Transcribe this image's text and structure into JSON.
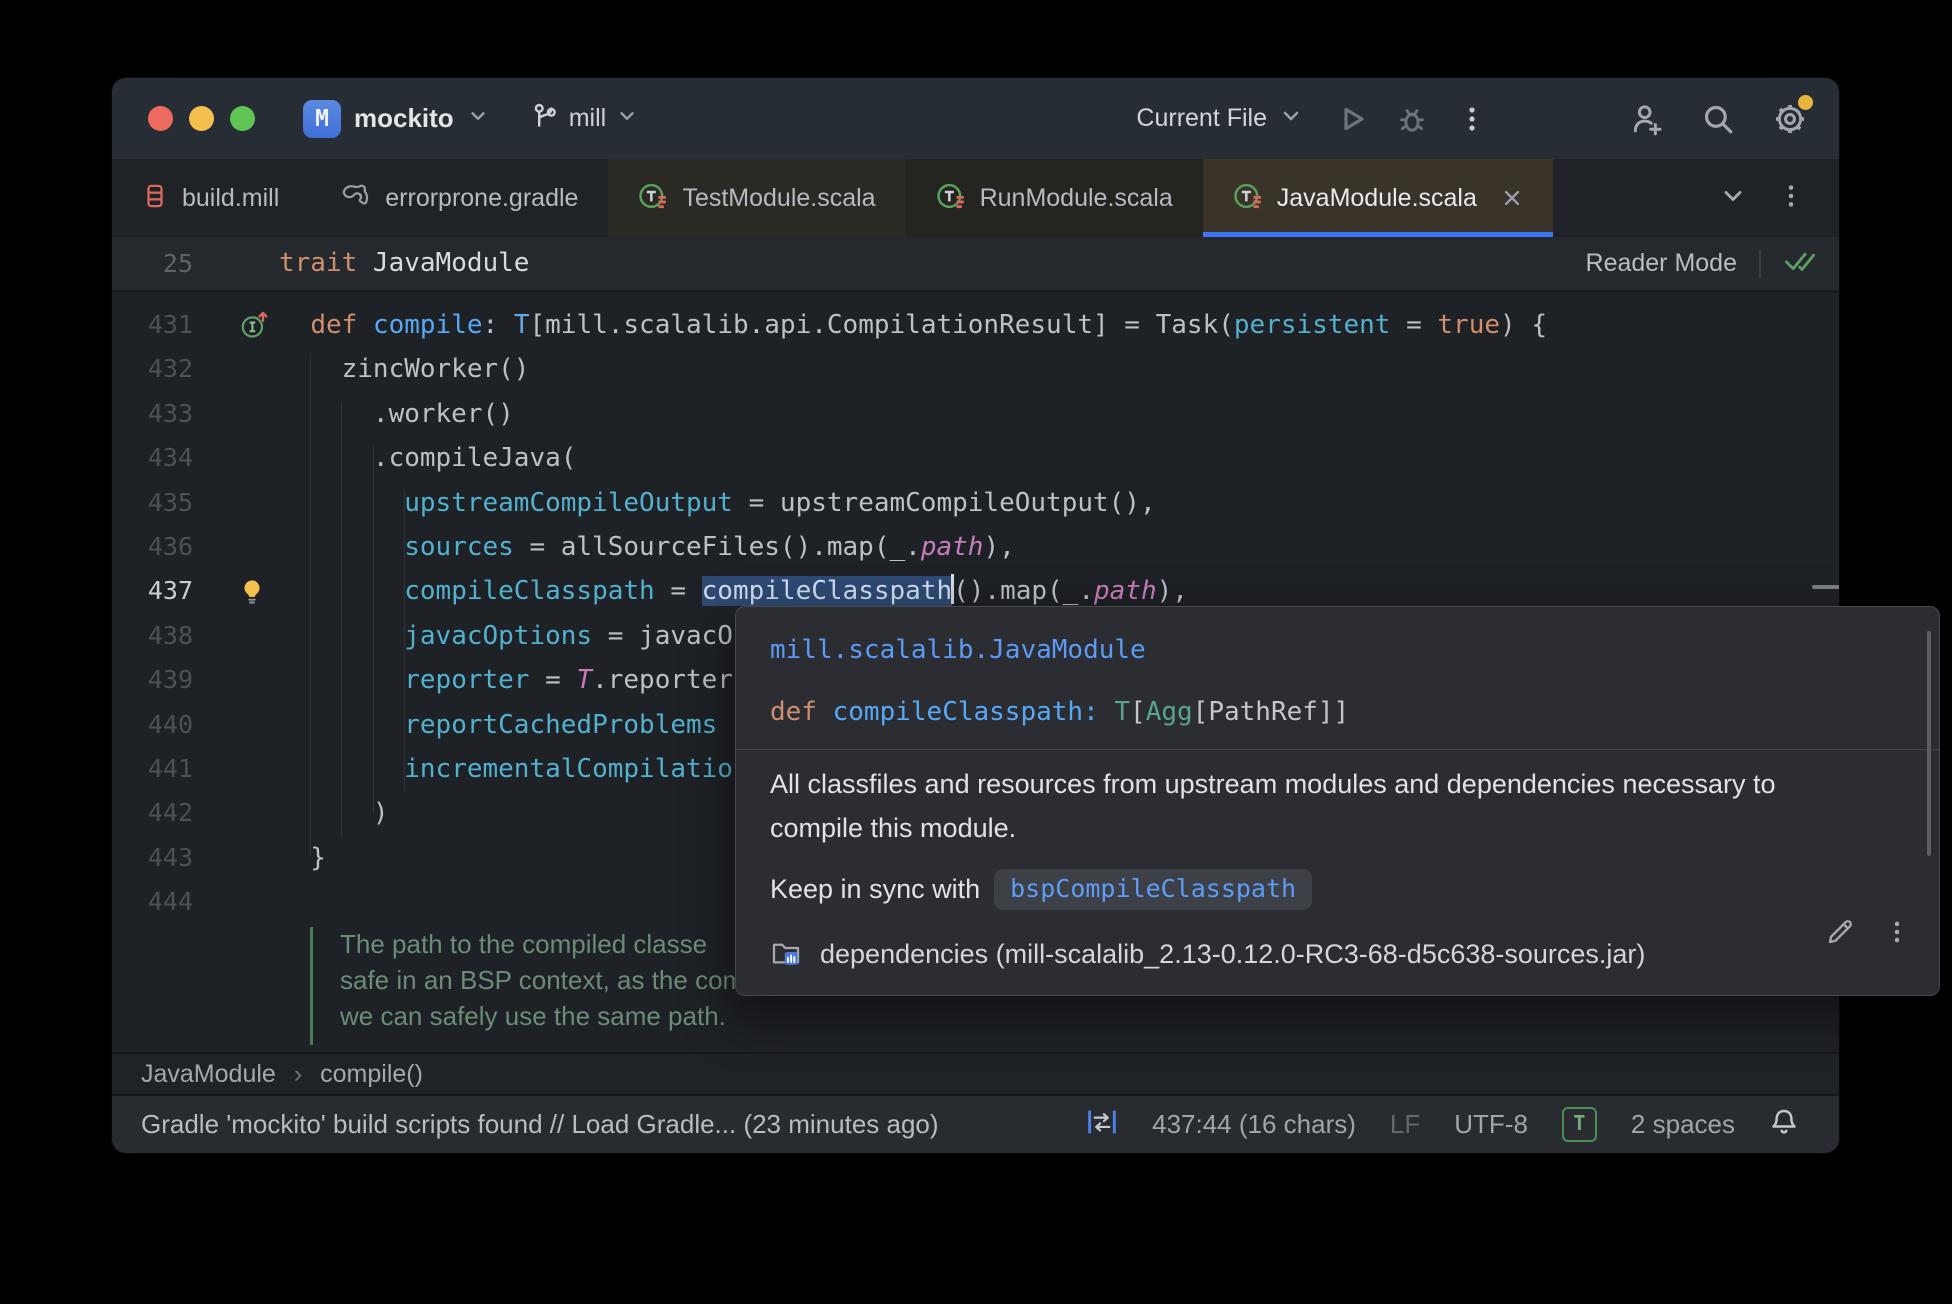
{
  "titlebar": {
    "project_badge": "M",
    "project_name": "mockito",
    "branch_name": "mill",
    "run_config": "Current File"
  },
  "tabs": [
    {
      "label": "build.mill"
    },
    {
      "label": "errorprone.gradle"
    },
    {
      "label": "TestModule.scala"
    },
    {
      "label": "RunModule.scala"
    },
    {
      "label": "JavaModule.scala",
      "active": true
    }
  ],
  "sticky_header": {
    "line_number": "25",
    "code": [
      {
        "t": "trait ",
        "c": "kw"
      },
      {
        "t": "JavaModule",
        "c": "plain2"
      }
    ],
    "reader_mode_label": "Reader Mode"
  },
  "editor": {
    "lines": [
      {
        "num": "431",
        "segments": [
          {
            "t": "  ",
            "c": "plain"
          },
          {
            "t": "def ",
            "c": "kw"
          },
          {
            "t": "compile",
            "c": "fn"
          },
          {
            "t": ": ",
            "c": "plain"
          },
          {
            "t": "T",
            "c": "type"
          },
          {
            "t": "[mill.scalalib.api.CompilationResult] = Task(",
            "c": "plain"
          },
          {
            "t": "persistent",
            "c": "param"
          },
          {
            "t": " = ",
            "c": "plain"
          },
          {
            "t": "true",
            "c": "kw"
          },
          {
            "t": ") {",
            "c": "plain"
          }
        ]
      },
      {
        "num": "432",
        "segments": [
          {
            "t": "    zincWorker()",
            "c": "plain"
          }
        ]
      },
      {
        "num": "433",
        "segments": [
          {
            "t": "      .worker()",
            "c": "plain"
          }
        ]
      },
      {
        "num": "434",
        "segments": [
          {
            "t": "      .compileJava(",
            "c": "plain"
          }
        ]
      },
      {
        "num": "435",
        "segments": [
          {
            "t": "        ",
            "c": "plain"
          },
          {
            "t": "upstreamCompileOutput",
            "c": "param"
          },
          {
            "t": " = upstreamCompileOutput(),",
            "c": "plain"
          }
        ]
      },
      {
        "num": "436",
        "segments": [
          {
            "t": "        ",
            "c": "plain"
          },
          {
            "t": "sources",
            "c": "param"
          },
          {
            "t": " = allSourceFiles().map(_.",
            "c": "plain"
          },
          {
            "t": "path",
            "c": "field"
          },
          {
            "t": "),",
            "c": "plain"
          }
        ]
      },
      {
        "num": "437",
        "segments": [
          {
            "t": "        ",
            "c": "plain"
          },
          {
            "t": "compileClasspath",
            "c": "param"
          },
          {
            "t": " = ",
            "c": "plain"
          },
          {
            "t": "compileClasspath",
            "c": "sel"
          },
          {
            "t": "",
            "c": "caret"
          },
          {
            "t": "().map(_.",
            "c": "plain"
          },
          {
            "t": "path",
            "c": "field"
          },
          {
            "t": "),",
            "c": "plain"
          }
        ]
      },
      {
        "num": "438",
        "segments": [
          {
            "t": "        ",
            "c": "plain"
          },
          {
            "t": "javacOptions",
            "c": "param"
          },
          {
            "t": " = javacO",
            "c": "plain"
          }
        ]
      },
      {
        "num": "439",
        "segments": [
          {
            "t": "        ",
            "c": "plain"
          },
          {
            "t": "reporter",
            "c": "param"
          },
          {
            "t": " = ",
            "c": "plain"
          },
          {
            "t": "T",
            "c": "field"
          },
          {
            "t": ".reporter",
            "c": "plain"
          }
        ]
      },
      {
        "num": "440",
        "segments": [
          {
            "t": "        ",
            "c": "plain"
          },
          {
            "t": "reportCachedProblems ",
            "c": "param"
          }
        ]
      },
      {
        "num": "441",
        "segments": [
          {
            "t": "        ",
            "c": "plain"
          },
          {
            "t": "incrementalCompilatio",
            "c": "param"
          }
        ]
      },
      {
        "num": "442",
        "segments": [
          {
            "t": "      )",
            "c": "plain"
          }
        ]
      },
      {
        "num": "443",
        "segments": [
          {
            "t": "  }",
            "c": "plain"
          }
        ]
      },
      {
        "num": "444",
        "segments": []
      }
    ]
  },
  "doc_comment": {
    "lines": [
      "The path to the compiled classe",
      "safe in an BSP context, as the compilation done later will use the exact same compilation settings, so",
      "we can safely use the same path."
    ]
  },
  "popup": {
    "breadcrumb": "mill.scalalib.JavaModule",
    "signature": [
      {
        "t": "def ",
        "c": "kw"
      },
      {
        "t": "compileClasspath",
        "c": "fn"
      },
      {
        "t": ":",
        "c": "fn"
      },
      {
        "t": " ",
        "c": "plain"
      },
      {
        "t": "T",
        "c": "type2"
      },
      {
        "t": "[",
        "c": "plain"
      },
      {
        "t": "Agg",
        "c": "type2"
      },
      {
        "t": "[",
        "c": "plain"
      },
      {
        "t": "PathRef",
        "c": "plain"
      },
      {
        "t": "]]",
        "c": "plain"
      }
    ],
    "description_line1": "All classfiles and resources from upstream modules and dependencies necessary to",
    "description_line2": "compile this module.",
    "sync_text": "Keep in sync with",
    "sync_chip": "bspCompileClasspath",
    "footer_text": "dependencies (mill-scalalib_2.13-0.12.0-RC3-68-d5c638-sources.jar)"
  },
  "breadcrumbs": {
    "items": [
      "JavaModule",
      "compile()"
    ],
    "separator": "›"
  },
  "statusbar": {
    "message": "Gradle 'mockito' build scripts found // Load Gradle... (23 minutes ago)",
    "caret_position": "437:44 (16 chars)",
    "line_separator": "LF",
    "encoding": "UTF-8",
    "file_type_badge": "T",
    "indent": "2 spaces"
  },
  "colors": {
    "accent_blue": "#3e74f2",
    "selection_blue": "#2e4a73",
    "keyword_orange": "#cf8e6d",
    "function_blue": "#57a8f5",
    "named_arg_cyan": "#53b1cd",
    "field_purple": "#c77dbb",
    "doc_comment_green": "#6b8c76",
    "notification_yellow": "#e9b63d",
    "scala_icon_green": "#58a05c",
    "scala_icon_red": "#d8695c"
  }
}
